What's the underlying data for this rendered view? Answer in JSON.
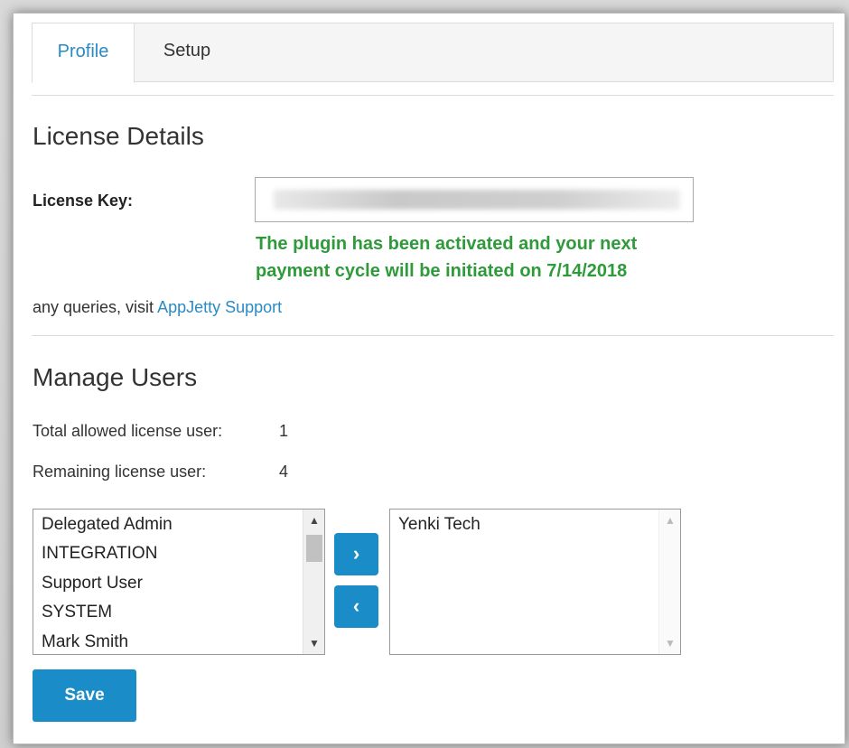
{
  "tabs": [
    {
      "label": "Profile",
      "active": true
    },
    {
      "label": "Setup",
      "active": false
    }
  ],
  "license": {
    "section_title": "License Details",
    "key_label": "License Key:",
    "success_line1": "The plugin has been activated and your next",
    "success_line2": "payment cycle will be initiated on 7/14/2018",
    "query_prefix": "any queries, visit ",
    "support_link": "AppJetty Support"
  },
  "users": {
    "section_title": "Manage Users",
    "total_label": "Total allowed license user:",
    "total_value": "1",
    "remaining_label": "Remaining license user:",
    "remaining_value": "4",
    "available": [
      "Delegated Admin",
      "INTEGRATION",
      "Support User",
      "SYSTEM",
      "Mark Smith"
    ],
    "selected": [
      "Yenki Tech"
    ],
    "move_right_icon": "chevron-right",
    "move_left_icon": "chevron-left",
    "save_label": "Save"
  },
  "colors": {
    "accent": "#1a8cc7",
    "link": "#2a8ac4",
    "success": "#2e9a3a"
  }
}
